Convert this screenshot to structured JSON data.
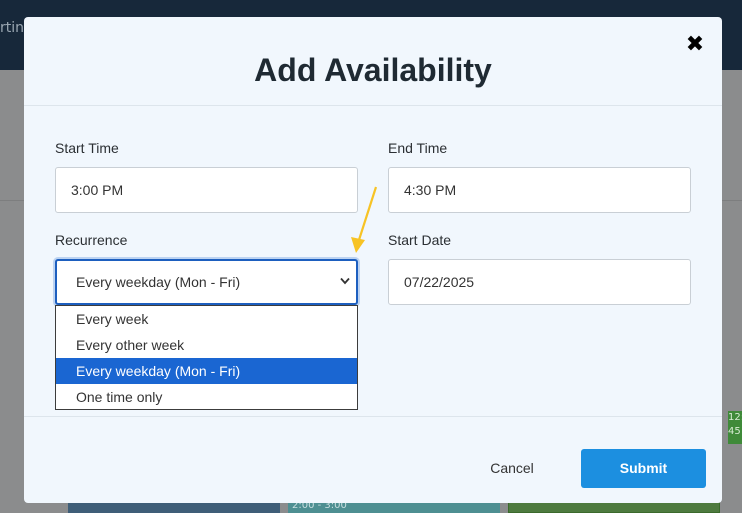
{
  "background": {
    "topbar_text": "rtin",
    "block_b_text": "2:00 - 3:00",
    "side_badge_text": "12: 45"
  },
  "modal": {
    "title": "Add Availability",
    "close_label": "✖",
    "start_time": {
      "label": "Start Time",
      "value": "3:00 PM"
    },
    "end_time": {
      "label": "End Time",
      "value": "4:30 PM"
    },
    "recurrence": {
      "label": "Recurrence",
      "selected": "Every weekday (Mon - Fri)",
      "options": [
        "Every week",
        "Every other week",
        "Every weekday (Mon - Fri)",
        "One time only"
      ]
    },
    "start_date": {
      "label": "Start Date",
      "value": "07/22/2025"
    },
    "cancel_label": "Cancel",
    "submit_label": "Submit"
  },
  "colors": {
    "accent": "#1c8fe0",
    "selected_option": "#1a66d2",
    "annotation_arrow": "#f7c325"
  }
}
